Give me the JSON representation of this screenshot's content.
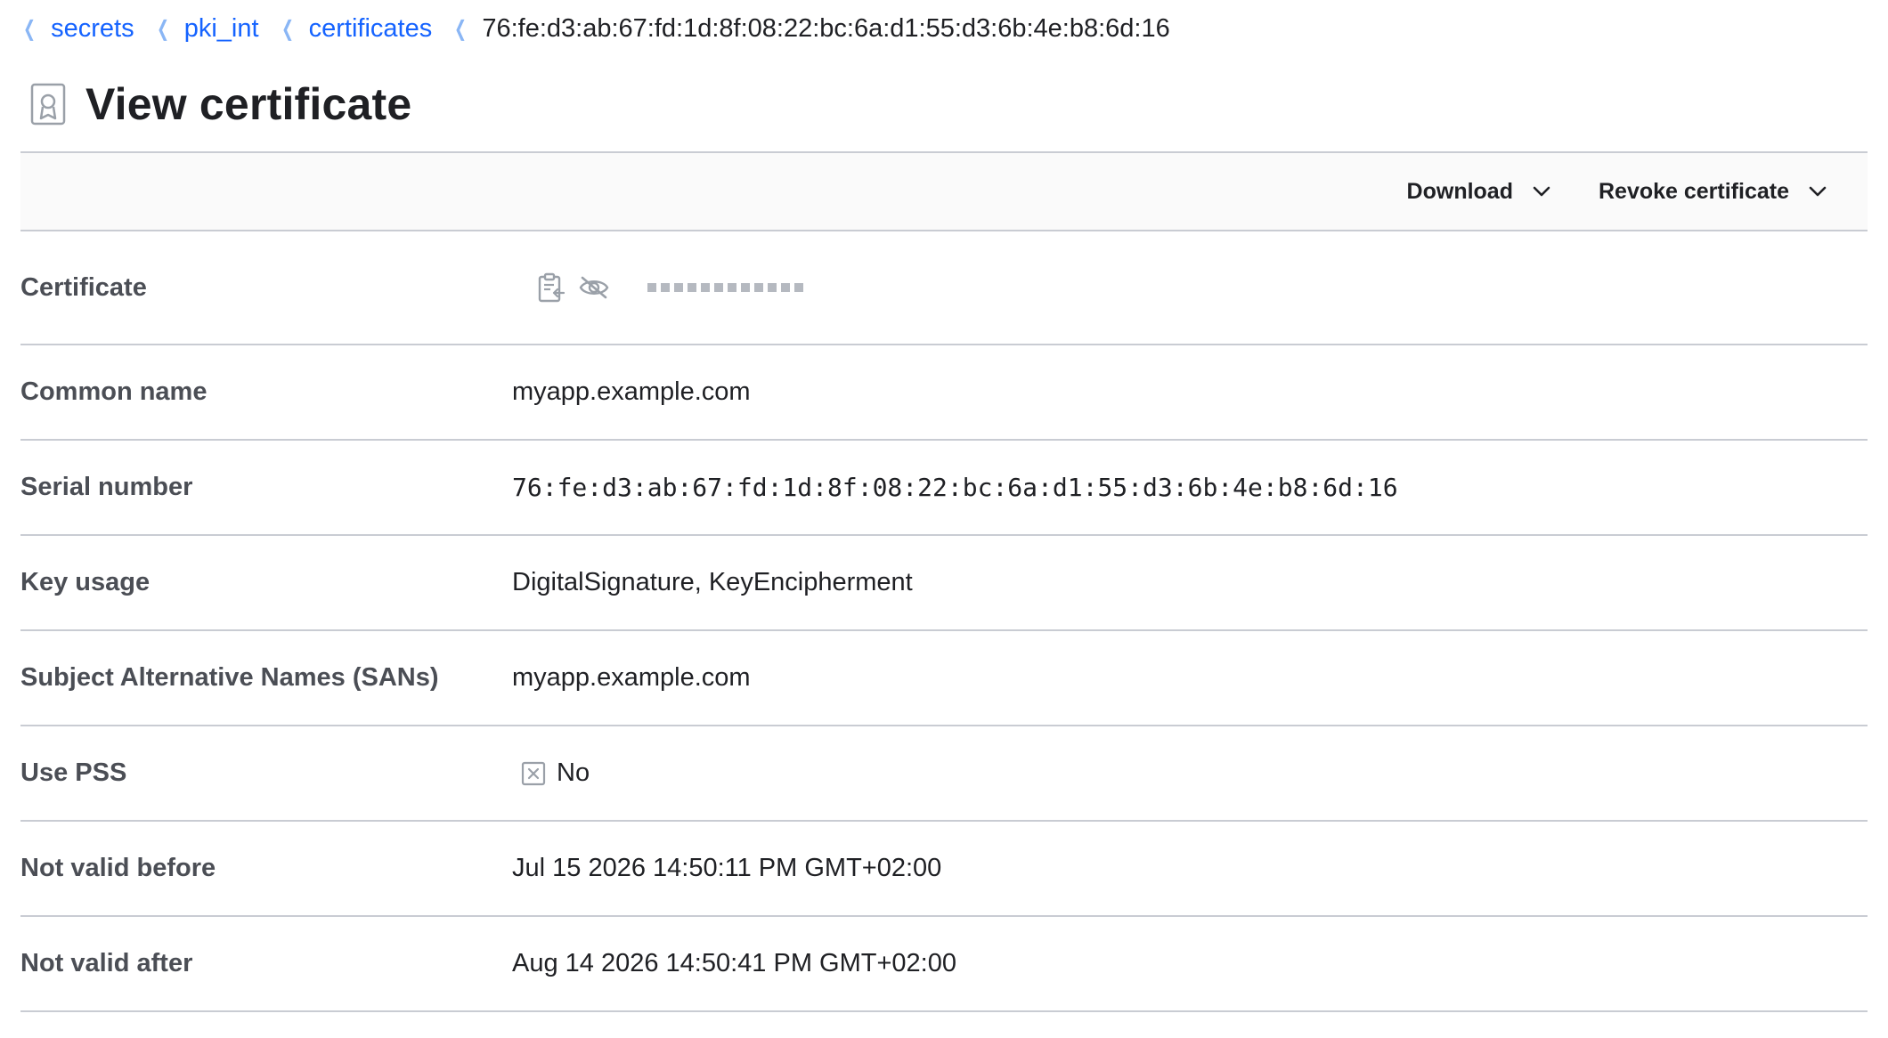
{
  "breadcrumb": {
    "items": [
      {
        "label": "secrets"
      },
      {
        "label": "pki_int"
      },
      {
        "label": "certificates"
      }
    ],
    "current": "76:fe:d3:ab:67:fd:1d:8f:08:22:bc:6a:d1:55:d3:6b:4e:b8:6d:16"
  },
  "page": {
    "title": "View certificate",
    "icon": "certificate-icon"
  },
  "toolbar": {
    "download_label": "Download",
    "revoke_label": "Revoke certificate"
  },
  "fields": {
    "certificate": {
      "label": "Certificate",
      "masked_dots": 12
    },
    "common_name": {
      "label": "Common name",
      "value": "myapp.example.com"
    },
    "serial_number": {
      "label": "Serial number",
      "value": "76:fe:d3:ab:67:fd:1d:8f:08:22:bc:6a:d1:55:d3:6b:4e:b8:6d:16"
    },
    "key_usage": {
      "label": "Key usage",
      "value": "DigitalSignature, KeyEncipherment"
    },
    "sans": {
      "label": "Subject Alternative Names (SANs)",
      "value": "myapp.example.com"
    },
    "use_pss": {
      "label": "Use PSS",
      "value": "No"
    },
    "not_valid_before": {
      "label": "Not valid before",
      "value": "Jul 15 2026 14:50:11 PM GMT+02:00"
    },
    "not_valid_after": {
      "label": "Not valid after",
      "value": "Aug 14 2026 14:50:41 PM GMT+02:00"
    }
  },
  "colors": {
    "link": "#1563ff",
    "border": "#c9ccd3",
    "label": "#4b4e55",
    "icon_muted": "#9aa0a8"
  }
}
